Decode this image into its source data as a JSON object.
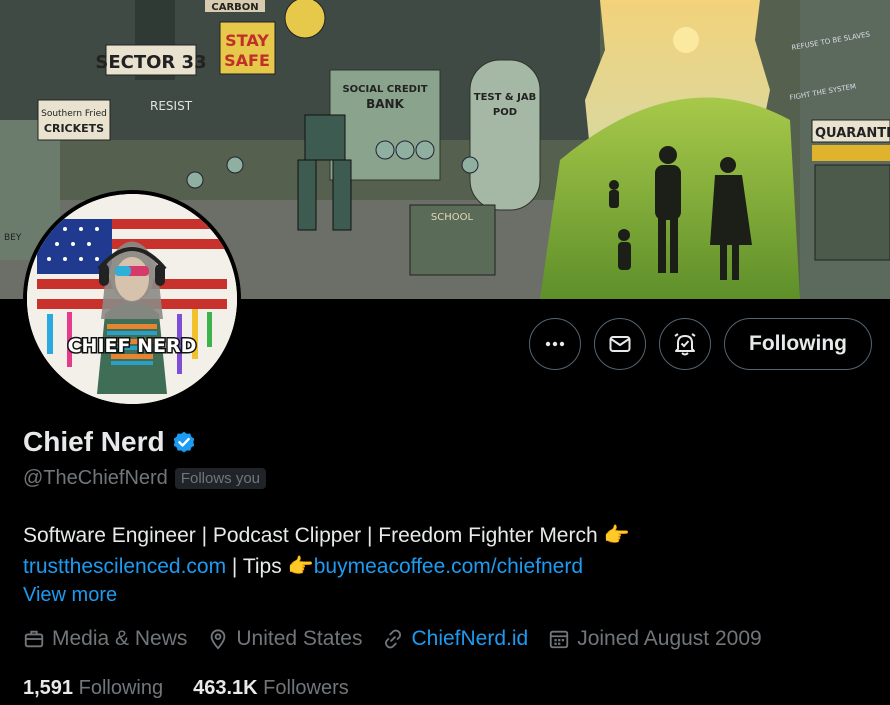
{
  "banner": {
    "signs": {
      "carbon": "CARBON",
      "sector": "SECTOR 33",
      "stay_safe_1": "STAY",
      "stay_safe_2": "SAFE",
      "resist": "RESIST",
      "southern_1": "Southern Fried",
      "southern_2": "CRICKETS",
      "social_credit_1": "SOCIAL CREDIT",
      "social_credit_2": "BANK",
      "test_jab_1": "TEST & JAB",
      "test_jab_2": "POD",
      "school": "SCHOOL",
      "quarantine": "QUARANTI",
      "refuse": "REFUSE TO BE SLAVES",
      "fight": "FIGHT THE SYSTEM",
      "bey": "BEY"
    }
  },
  "avatar": {
    "label": "CHIEF NERD"
  },
  "actions": {
    "more_icon": "more-icon",
    "message_icon": "envelope-icon",
    "notify_icon": "bell-icon",
    "following_label": "Following"
  },
  "profile": {
    "display_name": "Chief Nerd",
    "verified_icon": "verified-badge-icon",
    "handle": "@TheChiefNerd",
    "follows_you": "Follows you"
  },
  "bio": {
    "line1": "Software Engineer | Podcast Clipper | Freedom Fighter Merch",
    "pointer_emoji": "👉",
    "link1": "trustthescilenced.com",
    "separator": " | Tips ",
    "link2": "buymeacoffee.com/chiefnerd",
    "view_more": "View more"
  },
  "meta": {
    "category": "Media & News",
    "location": "United States",
    "website": "ChiefNerd.id",
    "joined": "Joined August 2009"
  },
  "stats": {
    "following_count": "1,591",
    "following_label": "Following",
    "followers_count": "463.1K",
    "followers_label": "Followers"
  },
  "colors": {
    "background": "#000000",
    "text": "#e7e9ea",
    "muted": "#71767b",
    "accent": "#1d9bf0"
  }
}
